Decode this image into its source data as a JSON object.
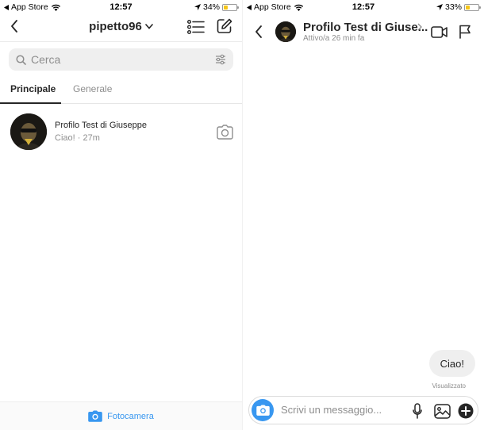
{
  "status_left": {
    "back_app": "App Store",
    "time": "12:57",
    "battery": "34%",
    "battery_level": 0.34
  },
  "status_right": {
    "back_app": "App Store",
    "time": "12:57",
    "battery": "33%",
    "battery_level": 0.33
  },
  "inbox": {
    "username": "pipetto96",
    "search_placeholder": "Cerca",
    "tabs": [
      {
        "label": "Principale",
        "active": true
      },
      {
        "label": "Generale",
        "active": false
      }
    ],
    "conversations": [
      {
        "name": "Profilo Test di Giuseppe",
        "preview": "Ciao! · 27m"
      }
    ],
    "footer_label": "Fotocamera"
  },
  "chat": {
    "title": "Profilo Test di Giuse...",
    "subtitle": "Attivo/a 26 min fa",
    "messages": [
      {
        "text": "Ciao!",
        "sender": "me"
      }
    ],
    "seen_label": "Visualizzato",
    "composer_placeholder": "Scrivi un messaggio..."
  },
  "colors": {
    "accent": "#3897f0",
    "text": "#262626",
    "secondary_text": "#8e8e8e",
    "battery": "#f5c518"
  },
  "icons": [
    "back-arrow-icon",
    "wifi-icon",
    "location-arrow-icon",
    "list-icon",
    "compose-icon",
    "search-icon",
    "filter-icon",
    "camera-icon",
    "video-call-icon",
    "flag-icon",
    "microphone-icon",
    "gallery-icon",
    "plus-icon",
    "chevron-down-icon",
    "chevron-right-icon"
  ]
}
